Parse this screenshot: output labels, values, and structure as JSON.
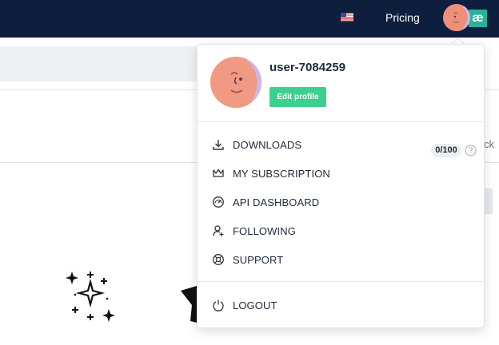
{
  "header": {
    "pricing_label": "Pricing",
    "language_flag": "us-flag-icon",
    "brand_badge": "æ"
  },
  "background": {
    "partial_text": "ck"
  },
  "dropdown": {
    "username": "user-7084259",
    "edit_profile_label": "Edit profile",
    "downloads_count": "0/100",
    "items": [
      {
        "label": "DOWNLOADS",
        "icon": "download-icon"
      },
      {
        "label": "MY SUBSCRIPTION",
        "icon": "crown-icon"
      },
      {
        "label": "API DASHBOARD",
        "icon": "gauge-icon"
      },
      {
        "label": "FOLLOWING",
        "icon": "user-plus-icon"
      },
      {
        "label": "SUPPORT",
        "icon": "lifebuoy-icon"
      }
    ],
    "logout_label": "LOGOUT"
  },
  "colors": {
    "topbar": "#0e1f3d",
    "accent_green": "#3ccf8e",
    "brand_teal": "#28b29a",
    "avatar": "#ee8f78"
  }
}
